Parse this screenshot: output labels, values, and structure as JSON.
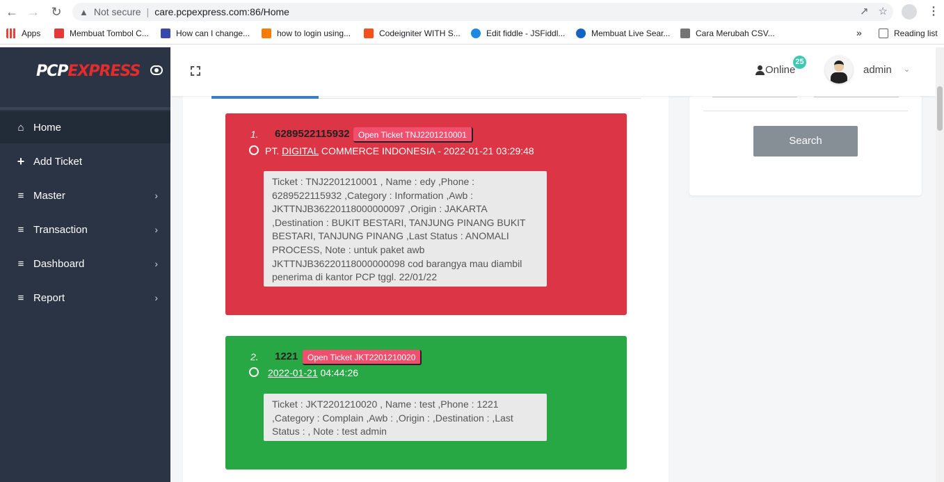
{
  "browser": {
    "security": "Not secure",
    "url": "care.pcpexpress.com:86/Home"
  },
  "bookmarks": {
    "apps": "Apps",
    "items": [
      {
        "label": "Membuat Tombol C...",
        "color": "#e53935"
      },
      {
        "label": "How can I change...",
        "color": "#3949ab"
      },
      {
        "label": "how to login using...",
        "color": "#f57c00"
      },
      {
        "label": "Codeigniter WITH S...",
        "color": "#f4511e"
      },
      {
        "label": "Edit fiddle - JSFiddl...",
        "color": "#1e88e5"
      },
      {
        "label": "Membuat Live Sear...",
        "color": "#1565c0"
      },
      {
        "label": "Cara Merubah CSV...",
        "color": "#757575"
      }
    ],
    "more": "»",
    "reading_list": "Reading list"
  },
  "sidebar": {
    "logo_pcp": "PCP",
    "logo_express": "EXPRESS",
    "items": [
      {
        "label": "Home",
        "icon": "home-icon"
      },
      {
        "label": "Add Ticket",
        "icon": "plus-icon"
      },
      {
        "label": "Master",
        "icon": "menu-icon"
      },
      {
        "label": "Transaction",
        "icon": "menu-icon"
      },
      {
        "label": "Dashboard",
        "icon": "menu-icon"
      },
      {
        "label": "Report",
        "icon": "menu-icon"
      }
    ]
  },
  "topbar": {
    "online_label": "Online",
    "online_count": "25",
    "user": "admin"
  },
  "tickets": [
    {
      "num": "1.",
      "phone": "6289522115932",
      "open_label": "Open Ticket TNJ2201210001",
      "company_pre": "PT. ",
      "company_ul": "DIGITAL",
      "company_post": " COMMERCE INDONESIA - 2022-01-21 03:29:48",
      "detail": "Ticket : TNJ2201210001 , Name : edy ,Phone : 6289522115932 ,Category : Information ,Awb : JKTTNJB36220118000000097 ,Origin : JAKARTA ,Destination : BUKIT BESTARI, TANJUNG PINANG BUKIT BESTARI, TANJUNG PINANG ,Last Status : ANOMALI PROCESS, Note : untuk paket awb JKTTNJB36220118000000098 cod barangya mau diambil penerima di kantor PCP tggl. 22/01/22"
    },
    {
      "num": "2.",
      "phone": "1221",
      "open_label": "Open Ticket JKT2201210020",
      "date_ul": "2022-01-21",
      "time": " 04:44:26",
      "detail": "Ticket : JKT2201210020 , Name : test ,Phone : 1221 ,Category : Complain ,Awb : ,Origin : ,Destination : ,Last Status : , Note : test admin"
    }
  ],
  "search": {
    "button": "Search"
  }
}
